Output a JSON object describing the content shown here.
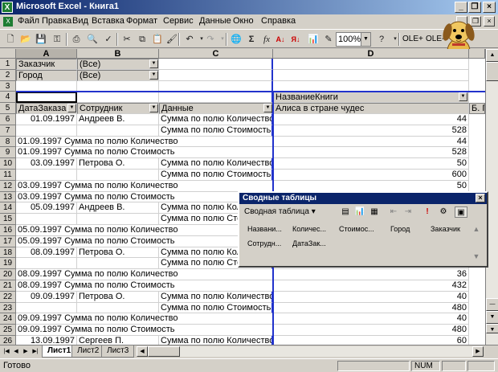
{
  "window": {
    "title": "Microsoft Excel - Книга1",
    "app_icon": "excel-icon"
  },
  "menu": {
    "items": [
      "Файл",
      "Правка",
      "Вид",
      "Вставка",
      "Формат",
      "Сервис",
      "Данные",
      "Окно",
      "Справка"
    ],
    "underline": [
      "Ф",
      "П",
      "В",
      "а",
      "о",
      "С",
      "Д",
      "О",
      "С"
    ]
  },
  "toolbar": {
    "zoom": "100%",
    "icons": [
      "new-icon",
      "open-icon",
      "save-icon",
      "permission-icon",
      "print-icon",
      "print-preview-icon",
      "spelling-icon",
      "cut-icon",
      "copy-icon",
      "paste-icon",
      "format-painter-icon",
      "undo-icon",
      "redo-icon",
      "hyperlink-icon",
      "autosum-icon",
      "function-icon",
      "sort-ascending-icon",
      "sort-descending-icon",
      "chart-wizard-icon",
      "map-icon",
      "drawing-icon",
      "help-icon"
    ],
    "ole_buttons": [
      "OLE+",
      "OLE-"
    ]
  },
  "columns": [
    "A",
    "B",
    "C",
    "D"
  ],
  "rows": [
    {
      "num": "1",
      "a": "Заказчик",
      "b": "(Все)",
      "c": "",
      "d": ""
    },
    {
      "num": "2",
      "a": "Город",
      "b": "(Все)",
      "c": "",
      "d": ""
    },
    {
      "num": "3",
      "a": "",
      "b": "",
      "c": "",
      "d": ""
    },
    {
      "num": "4",
      "a": "",
      "b": "",
      "c": "",
      "d": "НазваниеКниги"
    },
    {
      "num": "5",
      "a": "ДатаЗаказа",
      "b": "Сотрудник",
      "c": "Данные",
      "d": "Алиса в стране чудес",
      "e": "Б. Г"
    },
    {
      "num": "6",
      "a": "01.09.1997",
      "b": "Андреев В.",
      "c": "Сумма по полю Количество",
      "d": "44"
    },
    {
      "num": "7",
      "a": "",
      "b": "",
      "c": "Сумма по полю Стоимость",
      "d": "528"
    },
    {
      "num": "8",
      "a": "01.09.1997 Сумма по полю Количество",
      "b": "",
      "c": "",
      "d": "44"
    },
    {
      "num": "9",
      "a": "01.09.1997 Сумма по полю Стоимость",
      "b": "",
      "c": "",
      "d": "528"
    },
    {
      "num": "10",
      "a": "03.09.1997",
      "b": "Петрова О.",
      "c": "Сумма по полю Количество",
      "d": "50"
    },
    {
      "num": "11",
      "a": "",
      "b": "",
      "c": "Сумма по полю Стоимость",
      "d": "600"
    },
    {
      "num": "12",
      "a": "03.09.1997 Сумма по полю Количество",
      "b": "",
      "c": "",
      "d": "50"
    },
    {
      "num": "13",
      "a": "03.09.1997 Сумма по полю Стоимость",
      "b": "",
      "c": "",
      "d": ""
    },
    {
      "num": "14",
      "a": "05.09.1997",
      "b": "Андреев В.",
      "c": "Сумма по полю Количество",
      "d": ""
    },
    {
      "num": "15",
      "a": "",
      "b": "",
      "c": "Сумма по полю Стоимость",
      "d": ""
    },
    {
      "num": "16",
      "a": "05.09.1997 Сумма по полю Количество",
      "b": "",
      "c": "",
      "d": ""
    },
    {
      "num": "17",
      "a": "05.09.1997 Сумма по полю Стоимость",
      "b": "",
      "c": "",
      "d": ""
    },
    {
      "num": "18",
      "a": "08.09.1997",
      "b": "Петрова О.",
      "c": "Сумма по полю Количество",
      "d": ""
    },
    {
      "num": "19",
      "a": "",
      "b": "",
      "c": "Сумма по полю Стоимость",
      "d": ""
    },
    {
      "num": "20",
      "a": "08.09.1997 Сумма по полю Количество",
      "b": "",
      "c": "",
      "d": "36"
    },
    {
      "num": "21",
      "a": "08.09.1997 Сумма по полю Стоимость",
      "b": "",
      "c": "",
      "d": "432"
    },
    {
      "num": "22",
      "a": "09.09.1997",
      "b": "Петрова О.",
      "c": "Сумма по полю Количество",
      "d": "40"
    },
    {
      "num": "23",
      "a": "",
      "b": "",
      "c": "Сумма по полю Стоимость",
      "d": "480"
    },
    {
      "num": "24",
      "a": "09.09.1997 Сумма по полю Количество",
      "b": "",
      "c": "",
      "d": "40"
    },
    {
      "num": "25",
      "a": "09.09.1997 Сумма по полю Стоимость",
      "b": "",
      "c": "",
      "d": "480"
    },
    {
      "num": "26",
      "a": "13.09.1997",
      "b": "Сергеев П.",
      "c": "Сумма по полю Количество",
      "d": "60"
    }
  ],
  "sheets": [
    "Лист1",
    "Лист2",
    "Лист3"
  ],
  "status": {
    "ready": "Готово",
    "num": "NUM"
  },
  "pivot_toolbar": {
    "title": "Сводные таблицы",
    "menu_label": "Сводная таблица",
    "fields_row1": [
      "Назвaни...",
      "Количес...",
      "Стоимос...",
      "Город",
      "Заказчик"
    ],
    "fields_row2": [
      "Сотрудн...",
      "ДатаЗак..."
    ]
  },
  "assistant": {
    "name": "office-assistant-dog"
  }
}
